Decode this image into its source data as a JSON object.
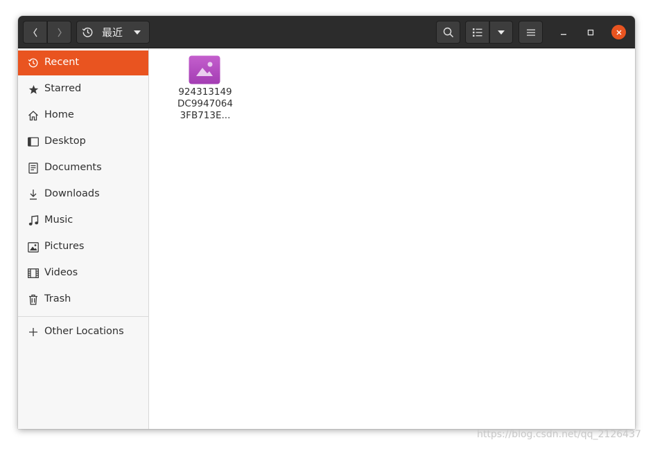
{
  "headerbar": {
    "location_label": "最近",
    "icons": {
      "back": "chevron-left-icon",
      "forward": "chevron-right-icon",
      "location": "recent-clock-icon",
      "location_dropdown": "triangle-down-icon",
      "search": "search-icon",
      "view_list": "list-view-icon",
      "view_dropdown": "triangle-down-icon",
      "menu": "hamburger-menu-icon",
      "minimize": "minimize-icon",
      "maximize": "maximize-icon",
      "close": "close-icon"
    }
  },
  "sidebar": {
    "items": [
      {
        "label": "Recent",
        "icon": "recent-clock-icon",
        "active": true
      },
      {
        "label": "Starred",
        "icon": "star-icon"
      },
      {
        "label": "Home",
        "icon": "home-icon"
      },
      {
        "label": "Desktop",
        "icon": "desktop-icon"
      },
      {
        "label": "Documents",
        "icon": "document-icon"
      },
      {
        "label": "Downloads",
        "icon": "download-icon"
      },
      {
        "label": "Music",
        "icon": "music-note-icon"
      },
      {
        "label": "Pictures",
        "icon": "picture-icon"
      },
      {
        "label": "Videos",
        "icon": "film-icon"
      },
      {
        "label": "Trash",
        "icon": "trash-icon"
      }
    ],
    "other_locations": {
      "label": "Other Locations",
      "icon": "plus-icon"
    }
  },
  "content": {
    "files": [
      {
        "name_lines": [
          "924313149",
          "DC9947064",
          "3FB713E..."
        ],
        "icon": "image-file-icon"
      }
    ]
  },
  "colors": {
    "accent": "#e95420",
    "headerbar": "#2c2c2c",
    "sidebar": "#f7f7f7",
    "image_icon": "#b34bc0"
  },
  "watermark": "https://blog.csdn.net/qq_2126437"
}
